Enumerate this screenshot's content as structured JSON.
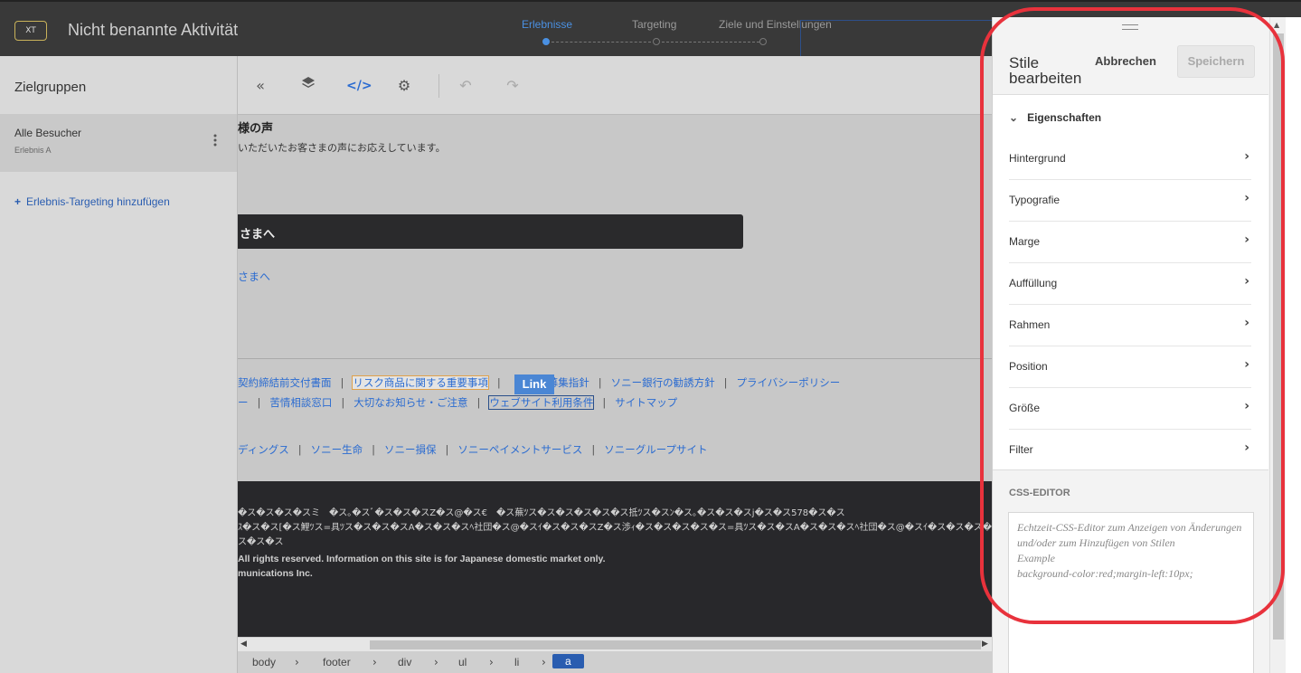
{
  "app": {
    "badge": "XT",
    "title": "Nicht benannte Aktivität"
  },
  "steps": [
    {
      "label": "Erlebnisse",
      "active": true
    },
    {
      "label": "Targeting",
      "active": false
    },
    {
      "label": "Ziele und Einstellungen",
      "active": false
    }
  ],
  "left_panel": {
    "title": "Zielgruppen",
    "audience": {
      "name": "Alle Besucher",
      "experience": "Erlebnis A",
      "more": "⋮"
    },
    "add_label": "Erlebnis-Targeting hinzufügen",
    "add_icon": "+"
  },
  "toolbar": {
    "collapse_icon": "«",
    "layers_icon": "◆",
    "code_icon": "</>",
    "settings_icon": "⚙",
    "undo_icon": "↶",
    "redo_icon": "↷"
  },
  "content": {
    "heading": "様の声",
    "subtext": "いただいたお客さまの声にお応えしています。",
    "black_bar_text": "さまへ",
    "link1": "さまへ",
    "row1": [
      "契約締結前交付書面",
      "リスク商品に関する重要事項",
      "勧誘方針等",
      "募集指針",
      "ソニー銀行の勧誘方針",
      "プライバシーポリシー"
    ],
    "row2": [
      "ー",
      "苦情相談窓口",
      "大切なお知らせ・ご注意",
      "ウェブサイト利用条件",
      "サイトマップ"
    ],
    "row3": [
      "ディングス",
      "ソニー生命",
      "ソニー損保",
      "ソニーペイメントサービス",
      "ソニーグループサイト"
    ],
    "link_badge": "Link",
    "footer_lines": [
      "�ス�ス�ス�スミ　�ス｡�スﾞ�ス�ス�スZ�ス@�ス€　�ス蕪ﾂス�ス�ス�ス�ス�ス抵ﾂス�スﾝ�ス｡�ス�ス�スj�ス�ス578�ス�ス",
      "ｽ�ス�ス[�ス鯉ﾂス=具ﾂス�ス�ス�スA�ス�ス�スﾍ社団�ス@�スｲ�ス�ス�スZ�ス渉ｨ�ス�ス�ス�ス�ス=具ﾂス�ス�スA�ス�ス�スﾍ社団�ス@�スｲ�ス�ス�ス�ス�ス�ス�ス",
      "ス�ス�ス"
    ],
    "copyright": "All rights reserved. Information on this site is for Japanese domestic market only.",
    "company": "munications Inc."
  },
  "breadcrumb": [
    "body",
    "footer",
    "div",
    "ul",
    "li",
    "a"
  ],
  "right_panel": {
    "title": "Stile bearbeiten",
    "cancel": "Abbrechen",
    "save": "Speichern",
    "section": "Eigenschaften",
    "items": [
      "Hintergrund",
      "Typografie",
      "Marge",
      "Auffüllung",
      "Rahmen",
      "Position",
      "Größe",
      "Filter"
    ],
    "css_label": "CSS-EDITOR",
    "css_placeholder": "Echtzeit-CSS-Editor zum Anzeigen von Änderungen und/oder zum Hinzufügen von Stilen\nExample\nbackground-color:red;margin-left:10px;"
  },
  "colors": {
    "accent": "#4a90e2",
    "highlight": "#e8323c",
    "link": "#2a6bd1"
  }
}
